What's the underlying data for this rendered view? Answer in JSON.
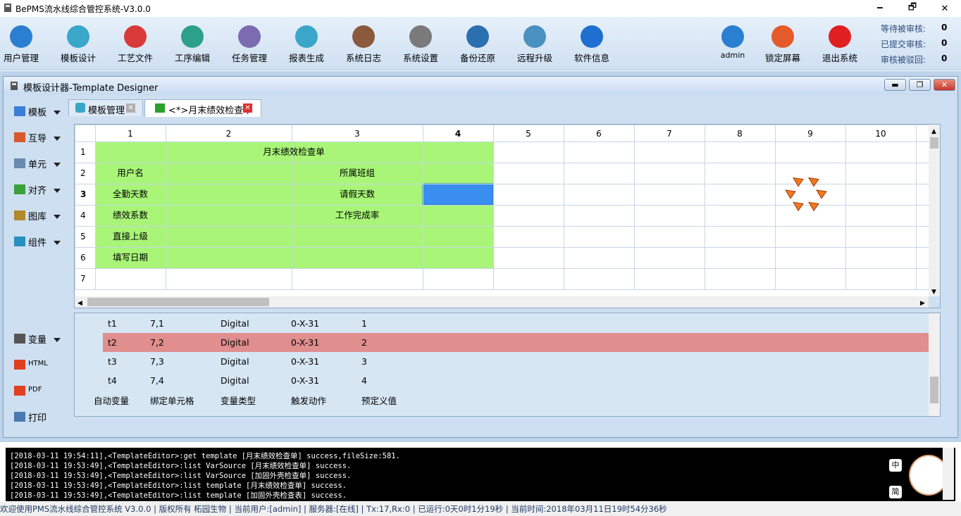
{
  "window": {
    "title": "BePMS流水线综合管控系统-V3.0.0",
    "min": "🗕",
    "max": "🗗",
    "close": "✕"
  },
  "toolbar": [
    {
      "name": "users",
      "label": "用户管理",
      "color": "#2a7fd0"
    },
    {
      "name": "template",
      "label": "模板设计",
      "color": "#3aa6c9"
    },
    {
      "name": "process-file",
      "label": "工艺文件",
      "color": "#d83a3a"
    },
    {
      "name": "process-edit",
      "label": "工序编辑",
      "color": "#2ca08a"
    },
    {
      "name": "task",
      "label": "任务管理",
      "color": "#7c6bb0"
    },
    {
      "name": "report",
      "label": "报表生成",
      "color": "#3aa6c9"
    },
    {
      "name": "log",
      "label": "系统日志",
      "color": "#8b5a3c"
    },
    {
      "name": "settings",
      "label": "系统设置",
      "color": "#7a7a7a"
    },
    {
      "name": "backup",
      "label": "备份还原",
      "color": "#2a6fb0"
    },
    {
      "name": "upgrade",
      "label": "远程升级",
      "color": "#4a90c0"
    },
    {
      "name": "info",
      "label": "软件信息",
      "color": "#1f6fd0"
    }
  ],
  "right_tools": [
    {
      "name": "admin",
      "label": "admin",
      "color": "#2a7fd0"
    },
    {
      "name": "lock",
      "label": "锁定屏幕",
      "color": "#e55a2a"
    },
    {
      "name": "exit",
      "label": "退出系统",
      "color": "#e02020"
    }
  ],
  "status_counts": [
    {
      "label": "等待被审核:",
      "value": "0"
    },
    {
      "label": "已提交审核:",
      "value": "0"
    },
    {
      "label": "审核被驳回:",
      "value": "0"
    }
  ],
  "child": {
    "title": "模板设计器-Template Designer"
  },
  "side_top": [
    {
      "name": "template",
      "label": "模板"
    },
    {
      "name": "import-export",
      "label": "互导"
    },
    {
      "name": "cell",
      "label": "单元"
    },
    {
      "name": "align",
      "label": "对齐"
    },
    {
      "name": "gallery",
      "label": "图库"
    },
    {
      "name": "component",
      "label": "组件"
    }
  ],
  "side_bottom": [
    {
      "name": "variable",
      "label": "变量",
      "arrow": true
    },
    {
      "name": "html",
      "label": "HTML",
      "arrow": false
    },
    {
      "name": "pdf",
      "label": "PDF",
      "arrow": false
    },
    {
      "name": "print",
      "label": "打印",
      "arrow": false
    }
  ],
  "tabs": [
    {
      "label": "模板管理",
      "active": false
    },
    {
      "label": "<*>月末绩效检查单",
      "active": true
    }
  ],
  "grid": {
    "cols": [
      "1",
      "2",
      "3",
      "4",
      "5",
      "6",
      "7",
      "8",
      "9",
      "10"
    ],
    "rows": [
      "1",
      "2",
      "3",
      "4",
      "5",
      "6",
      "7"
    ],
    "cells": {
      "title": "月末绩效检查单",
      "username": "用户名",
      "team": "所属班组",
      "attendance": "全勤天数",
      "leave": "请假天数",
      "coefficient": "绩效系数",
      "completion": "工作完成率",
      "superior": "直接上级",
      "date": "填写日期"
    }
  },
  "variables": {
    "rows": [
      [
        "t1",
        "7,1",
        "Digital",
        "0-X-31",
        "1"
      ],
      [
        "t2",
        "7,2",
        "Digital",
        "0-X-31",
        "2"
      ],
      [
        "t3",
        "7,3",
        "Digital",
        "0-X-31",
        "3"
      ],
      [
        "t4",
        "7,4",
        "Digital",
        "0-X-31",
        "4"
      ]
    ],
    "selected_index": 1,
    "headers": [
      "自动变量",
      "绑定单元格",
      "变量类型",
      "触发动作",
      "预定义值"
    ]
  },
  "log": [
    "[2018-03-11 19:54:11],<TemplateEditor>:get template [月末绩效检查单] success,fileSize:581.",
    "[2018-03-11 19:53:49],<TemplateEditor>:list VarSource [月末绩效检查单] success.",
    "[2018-03-11 19:53:49],<TemplateEditor>:list VarSource [加固外壳检查单] success.",
    "[2018-03-11 19:53:49],<TemplateEditor>:list template [月末绩效检查单] success.",
    "[2018-03-11 19:53:49],<TemplateEditor>:list template [加固外壳检查表] success."
  ],
  "mascot": {
    "tag1": "中",
    "tag2": "简"
  },
  "statusbar": "欢迎使用PMS流水线综合管控系统 V3.0.0 | 版权所有 柘园生物 | 当前用户:[admin] | 服务器:[在线] | Tx:17,Rx:0 | 已运行:0天0时1分19秒 | 当前时间:2018年03月11日19时54分36秒"
}
